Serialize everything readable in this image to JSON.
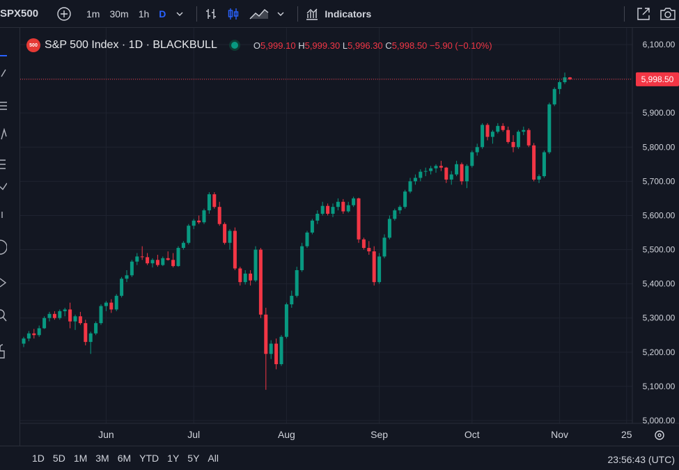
{
  "toolbar": {
    "symbol": "SPX500",
    "intervals": [
      "1m",
      "30m",
      "1h",
      "D"
    ],
    "active_interval": "D",
    "indicators_label": "Indicators"
  },
  "legend": {
    "badge": "500",
    "title": "S&P 500 Index · 1D · BLACKBULL",
    "o_label": "O",
    "o_value": "5,999.10",
    "h_label": "H",
    "h_value": "5,999.30",
    "l_label": "L",
    "l_value": "5,996.30",
    "c_label": "C",
    "c_value": "5,998.50",
    "change": "−5.90 (−0.10%)"
  },
  "price_label": "5,998.50",
  "y_ticks": [
    "6,100.00",
    "6,000.00",
    "5,900.00",
    "5,800.00",
    "5,700.00",
    "5,600.00",
    "5,500.00",
    "5,400.00",
    "5,300.00",
    "5,200.00",
    "5,100.00",
    "5,000.00"
  ],
  "x_ticks": [
    "Jun",
    "Jul",
    "Aug",
    "Sep",
    "Oct",
    "Nov",
    "25"
  ],
  "ranges": [
    "1D",
    "5D",
    "1M",
    "3M",
    "6M",
    "YTD",
    "1Y",
    "5Y",
    "All"
  ],
  "clock": "23:56:43 (UTC)",
  "colors": {
    "up": "#089981",
    "down": "#f23645",
    "bg": "#131722",
    "grid": "#1f2330"
  },
  "chart_data": {
    "type": "candlestick",
    "ylim": [
      5000,
      6100
    ],
    "last_price": 5998.5,
    "candles": [
      [
        5225,
        5245,
        5215,
        5240
      ],
      [
        5240,
        5262,
        5232,
        5255
      ],
      [
        5255,
        5268,
        5240,
        5250
      ],
      [
        5250,
        5278,
        5245,
        5270
      ],
      [
        5270,
        5305,
        5268,
        5300
      ],
      [
        5300,
        5318,
        5290,
        5312
      ],
      [
        5312,
        5320,
        5295,
        5300
      ],
      [
        5300,
        5325,
        5295,
        5320
      ],
      [
        5320,
        5330,
        5305,
        5325
      ],
      [
        5325,
        5345,
        5270,
        5290
      ],
      [
        5290,
        5310,
        5265,
        5305
      ],
      [
        5305,
        5318,
        5280,
        5285
      ],
      [
        5285,
        5295,
        5220,
        5230
      ],
      [
        5230,
        5260,
        5195,
        5255
      ],
      [
        5255,
        5290,
        5250,
        5285
      ],
      [
        5285,
        5340,
        5280,
        5335
      ],
      [
        5335,
        5350,
        5320,
        5345
      ],
      [
        5345,
        5355,
        5315,
        5325
      ],
      [
        5325,
        5370,
        5320,
        5365
      ],
      [
        5365,
        5420,
        5360,
        5415
      ],
      [
        5415,
        5440,
        5405,
        5425
      ],
      [
        5425,
        5470,
        5420,
        5465
      ],
      [
        5465,
        5490,
        5455,
        5480
      ],
      [
        5480,
        5510,
        5470,
        5478
      ],
      [
        5478,
        5490,
        5455,
        5460
      ],
      [
        5460,
        5475,
        5448,
        5470
      ],
      [
        5470,
        5485,
        5450,
        5455
      ],
      [
        5455,
        5480,
        5452,
        5475
      ],
      [
        5475,
        5495,
        5468,
        5470
      ],
      [
        5470,
        5490,
        5448,
        5452
      ],
      [
        5452,
        5510,
        5450,
        5505
      ],
      [
        5505,
        5525,
        5500,
        5520
      ],
      [
        5520,
        5575,
        5515,
        5570
      ],
      [
        5570,
        5590,
        5560,
        5585
      ],
      [
        5585,
        5600,
        5575,
        5580
      ],
      [
        5580,
        5620,
        5575,
        5615
      ],
      [
        5615,
        5668,
        5605,
        5662
      ],
      [
        5662,
        5668,
        5620,
        5625
      ],
      [
        5625,
        5640,
        5570,
        5575
      ],
      [
        5575,
        5580,
        5515,
        5520
      ],
      [
        5520,
        5560,
        5500,
        5555
      ],
      [
        5555,
        5565,
        5440,
        5445
      ],
      [
        5445,
        5450,
        5395,
        5405
      ],
      [
        5405,
        5440,
        5398,
        5430
      ],
      [
        5430,
        5440,
        5395,
        5410
      ],
      [
        5410,
        5510,
        5405,
        5500
      ],
      [
        5500,
        5505,
        5300,
        5310
      ],
      [
        5310,
        5330,
        5090,
        5195
      ],
      [
        5195,
        5235,
        5180,
        5225
      ],
      [
        5225,
        5240,
        5150,
        5165
      ],
      [
        5165,
        5250,
        5160,
        5245
      ],
      [
        5245,
        5345,
        5240,
        5340
      ],
      [
        5340,
        5380,
        5330,
        5365
      ],
      [
        5365,
        5450,
        5360,
        5440
      ],
      [
        5440,
        5520,
        5435,
        5510
      ],
      [
        5510,
        5555,
        5505,
        5550
      ],
      [
        5550,
        5590,
        5545,
        5585
      ],
      [
        5585,
        5615,
        5575,
        5605
      ],
      [
        5605,
        5640,
        5600,
        5628
      ],
      [
        5628,
        5635,
        5600,
        5605
      ],
      [
        5605,
        5635,
        5595,
        5625
      ],
      [
        5625,
        5650,
        5615,
        5640
      ],
      [
        5640,
        5648,
        5605,
        5612
      ],
      [
        5612,
        5640,
        5608,
        5630
      ],
      [
        5630,
        5655,
        5625,
        5650
      ],
      [
        5650,
        5652,
        5520,
        5530
      ],
      [
        5530,
        5535,
        5500,
        5505
      ],
      [
        5505,
        5525,
        5485,
        5495
      ],
      [
        5495,
        5510,
        5395,
        5405
      ],
      [
        5405,
        5490,
        5400,
        5480
      ],
      [
        5480,
        5545,
        5475,
        5535
      ],
      [
        5535,
        5600,
        5530,
        5590
      ],
      [
        5590,
        5620,
        5585,
        5615
      ],
      [
        5615,
        5630,
        5605,
        5625
      ],
      [
        5625,
        5675,
        5620,
        5670
      ],
      [
        5670,
        5710,
        5665,
        5700
      ],
      [
        5700,
        5720,
        5690,
        5710
      ],
      [
        5710,
        5735,
        5700,
        5728
      ],
      [
        5728,
        5740,
        5715,
        5730
      ],
      [
        5730,
        5745,
        5720,
        5738
      ],
      [
        5738,
        5750,
        5725,
        5745
      ],
      [
        5745,
        5760,
        5730,
        5740
      ],
      [
        5740,
        5742,
        5695,
        5705
      ],
      [
        5705,
        5730,
        5690,
        5720
      ],
      [
        5720,
        5760,
        5715,
        5750
      ],
      [
        5750,
        5755,
        5690,
        5700
      ],
      [
        5700,
        5750,
        5680,
        5745
      ],
      [
        5745,
        5790,
        5740,
        5785
      ],
      [
        5785,
        5810,
        5775,
        5800
      ],
      [
        5800,
        5870,
        5795,
        5865
      ],
      [
        5865,
        5870,
        5820,
        5830
      ],
      [
        5830,
        5850,
        5810,
        5845
      ],
      [
        5845,
        5870,
        5840,
        5862
      ],
      [
        5862,
        5870,
        5845,
        5850
      ],
      [
        5850,
        5860,
        5810,
        5815
      ],
      [
        5815,
        5835,
        5785,
        5800
      ],
      [
        5800,
        5850,
        5795,
        5845
      ],
      [
        5845,
        5860,
        5835,
        5850
      ],
      [
        5850,
        5855,
        5800,
        5805
      ],
      [
        5805,
        5812,
        5700,
        5705
      ],
      [
        5705,
        5720,
        5695,
        5715
      ],
      [
        5715,
        5790,
        5710,
        5785
      ],
      [
        5785,
        5930,
        5780,
        5925
      ],
      [
        5925,
        5975,
        5920,
        5970
      ],
      [
        5970,
        5995,
        5955,
        5990
      ],
      [
        5990,
        6018,
        5985,
        6004
      ],
      [
        6004,
        6005,
        5996,
        5998.5
      ]
    ]
  }
}
